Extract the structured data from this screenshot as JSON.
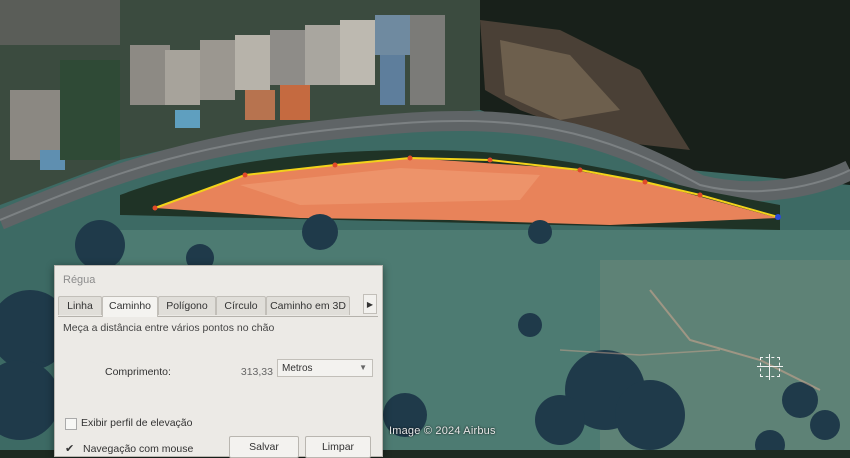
{
  "map": {
    "watermark": "Image © 2024 Airbus",
    "path_color": "#f2d21a",
    "area_color": "#e8835a"
  },
  "dialog": {
    "title": "Régua",
    "tabs": [
      {
        "label": "Linha",
        "active": false
      },
      {
        "label": "Caminho",
        "active": true
      },
      {
        "label": "Polígono",
        "active": false
      },
      {
        "label": "Círculo",
        "active": false
      },
      {
        "label": "Caminho em 3D",
        "active": false
      }
    ],
    "description": "Meça a distância entre vários pontos no chão",
    "length_label": "Comprimento:",
    "length_value": "313,33",
    "unit": "Metros",
    "elevation_label": "Exibir perfil de elevação",
    "mouse_nav_label": "Navegação com mouse",
    "save_label": "Salvar",
    "clear_label": "Limpar"
  }
}
